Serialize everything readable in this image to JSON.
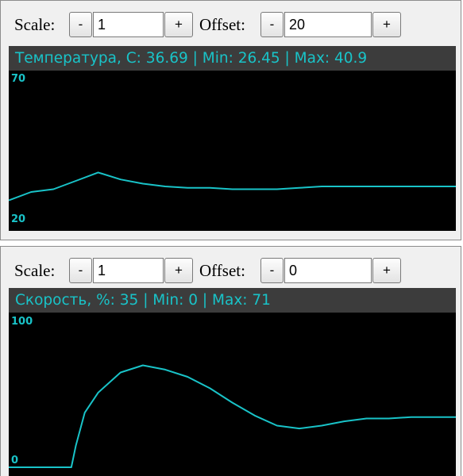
{
  "panels": [
    {
      "scale_label": "Scale:",
      "scale_minus": "-",
      "scale_value": "1",
      "scale_plus": "+",
      "offset_label": "Offset:",
      "offset_minus": "-",
      "offset_value": "20",
      "offset_plus": "+",
      "title": "Температура, C: 36.69 | Min: 26.45 | Max: 40.9",
      "y_max_label": "70",
      "y_min_label": "20"
    },
    {
      "scale_label": "Scale:",
      "scale_minus": "-",
      "scale_value": "1",
      "scale_plus": "+",
      "offset_label": "Offset:",
      "offset_minus": "-",
      "offset_value": "0",
      "offset_plus": "+",
      "title": "Скорость, %: 35 | Min: 0 | Max: 71",
      "y_max_label": "100",
      "y_min_label": "0"
    }
  ],
  "chart_data": [
    {
      "type": "line",
      "title": "Температура, C: 36.69 | Min: 26.45 | Max: 40.9",
      "ylim": [
        20,
        70
      ],
      "x": [
        0,
        5,
        10,
        15,
        20,
        25,
        30,
        35,
        40,
        45,
        50,
        55,
        60,
        65,
        70,
        75,
        80,
        85,
        90,
        95,
        100
      ],
      "values": [
        27.5,
        30.5,
        31.5,
        34.5,
        37.5,
        35.0,
        33.5,
        32.5,
        32.0,
        32.0,
        31.5,
        31.5,
        31.5,
        32.0,
        32.5,
        32.5,
        32.5,
        32.5,
        32.5,
        32.5,
        32.5
      ],
      "color": "#19c3c8",
      "grid": false
    },
    {
      "type": "line",
      "title": "Скорость, %: 35 | Min: 0 | Max: 71",
      "ylim": [
        0,
        100
      ],
      "x": [
        0,
        5,
        10,
        14,
        15,
        17,
        20,
        25,
        30,
        35,
        40,
        45,
        50,
        55,
        60,
        65,
        70,
        75,
        80,
        85,
        90,
        95,
        100
      ],
      "values": [
        0,
        0,
        0,
        0,
        15,
        38,
        52,
        66,
        71,
        68,
        63,
        55,
        45,
        36,
        29,
        27,
        29,
        32,
        34,
        34,
        35,
        35,
        35
      ],
      "color": "#19c3c8",
      "grid": false
    }
  ]
}
